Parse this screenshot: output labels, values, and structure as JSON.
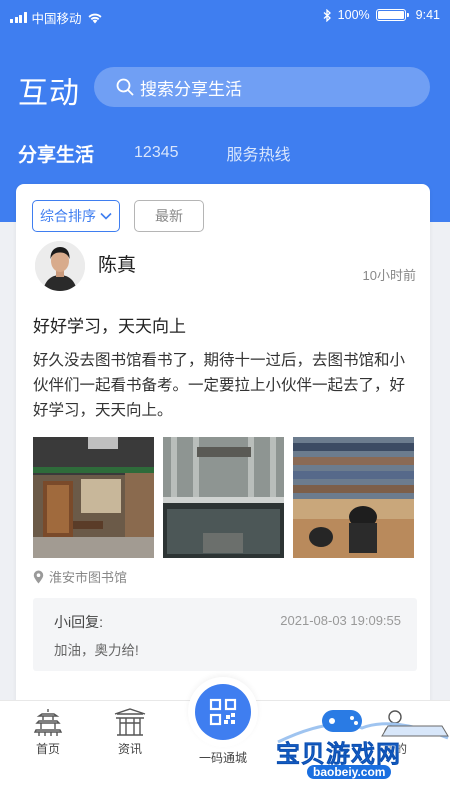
{
  "status_bar": {
    "carrier": "中国移动",
    "battery": "100%",
    "battery_level": 1.0,
    "time": "9:41"
  },
  "header": {
    "title": "互动",
    "search_placeholder": "搜索分享生活"
  },
  "tabs": [
    {
      "label": "分享生活",
      "active": true
    },
    {
      "label": "12345",
      "active": false
    },
    {
      "label": "服务热线",
      "active": false
    }
  ],
  "filters": {
    "sort_label": "综合排序",
    "newest_label": "最新"
  },
  "post": {
    "author": "陈真",
    "time": "10小时前",
    "title": "好好学习，天天向上",
    "body": "好久没去图书馆看书了，期待十一过后，去图书馆和小伙伴们一起看书备考。一定要拉上小伙伴一起去了，好好学习，天天向上。",
    "location": "淮安市图书馆",
    "reply": {
      "label": "小i回复:",
      "time": "2021-08-03  19:09:55",
      "text": "加油，奥力给!"
    }
  },
  "bottom_nav": [
    {
      "label": "首页",
      "icon": "pagoda-icon"
    },
    {
      "label": "资讯",
      "icon": "gate-icon"
    },
    {
      "label": "一码通城",
      "icon": "qr-code-icon"
    },
    {
      "label": "我的",
      "icon": "person-icon"
    }
  ],
  "watermark": {
    "title": "宝贝游戏网",
    "url": "baobeiy.com"
  },
  "colors": {
    "primary": "#3f7ef0",
    "background": "#eef0f4"
  }
}
